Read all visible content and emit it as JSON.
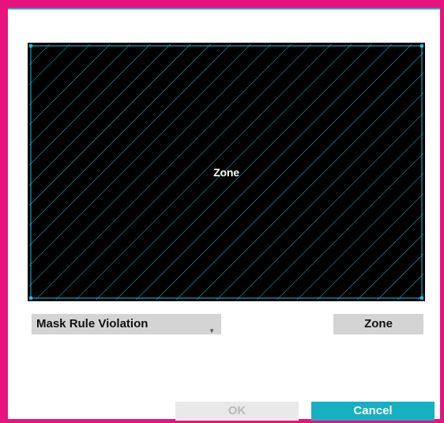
{
  "zone_area": {
    "label": "Zone",
    "hatch_color": "#1fbfdc",
    "background": "#000000"
  },
  "rule_dropdown": {
    "selected": "Mask Rule Violation",
    "arrow": "▼",
    "icon": "chevron-down-icon"
  },
  "buttons": {
    "zone": "Zone",
    "ok": "OK",
    "cancel": "Cancel"
  },
  "colors": {
    "frame": "#e8127f",
    "accent": "#16b0c2",
    "ok_disabled": "#b8b8b8"
  }
}
